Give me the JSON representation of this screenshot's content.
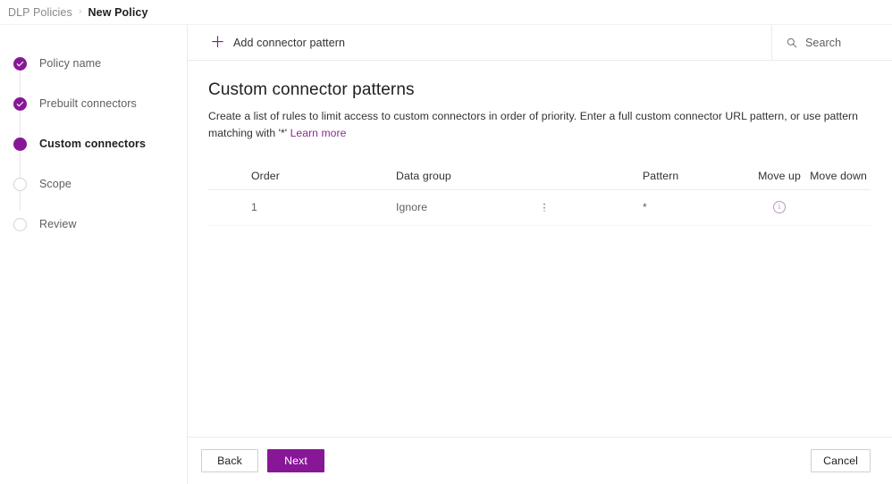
{
  "breadcrumb": {
    "parent": "DLP Policies",
    "separator": "›",
    "current": "New Policy"
  },
  "sidebar": {
    "steps": [
      {
        "label": "Policy name",
        "state": "done"
      },
      {
        "label": "Prebuilt connectors",
        "state": "done"
      },
      {
        "label": "Custom connectors",
        "state": "active"
      },
      {
        "label": "Scope",
        "state": "todo"
      },
      {
        "label": "Review",
        "state": "todo"
      }
    ]
  },
  "command_bar": {
    "add_label": "Add connector pattern",
    "add_icon": "plus-icon",
    "search_placeholder": "Search",
    "search_icon": "search-icon"
  },
  "main": {
    "title": "Custom connector patterns",
    "description": "Create a list of rules to limit access to custom connectors in order of priority. Enter a full custom connector URL pattern, or use pattern matching with '*'",
    "learn_more": "Learn more"
  },
  "table": {
    "columns": [
      "Order",
      "Data group",
      "Pattern",
      "Move up",
      "Move down"
    ],
    "rows": [
      {
        "order": "1",
        "data_group": "Ignore",
        "pattern": "*",
        "move_up": "ⓘ",
        "move_down": ""
      }
    ]
  },
  "footer": {
    "back": "Back",
    "next": "Next",
    "cancel": "Cancel"
  },
  "colors": {
    "accent": "#881798",
    "link": "#8f2d8f",
    "text_primary": "#201f1e",
    "text_secondary": "#605e5c",
    "border": "#edebe9",
    "info_icon": "#b996bf"
  }
}
